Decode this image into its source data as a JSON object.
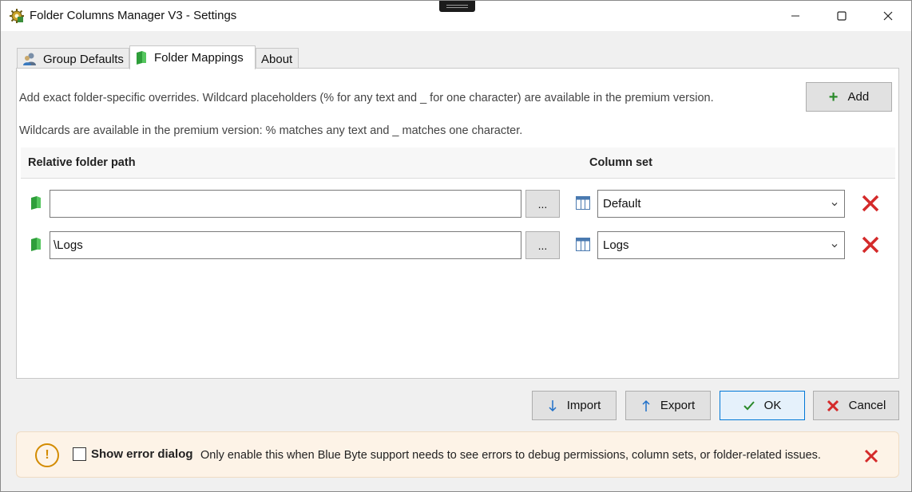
{
  "window": {
    "title": "Folder Columns Manager V3 - Settings"
  },
  "tabs": [
    {
      "label": "Group Defaults",
      "icon": "user-group-icon",
      "active": false
    },
    {
      "label": "Folder Mappings",
      "icon": "green-folder-icon",
      "active": true
    },
    {
      "label": "About",
      "icon": "",
      "active": false
    }
  ],
  "mappings": {
    "description_1": "Add exact folder-specific overrides. Wildcard placeholders (% for any text and _ for one character) are available in the premium version.",
    "description_2": "Wildcards are available in the premium version: % matches any text and _ matches one character.",
    "add_label": "Add",
    "columns": {
      "path": "Relative folder path",
      "column_set": "Column set"
    },
    "browse_label": "...",
    "rows": [
      {
        "path": "",
        "column_set": "Default"
      },
      {
        "path": "\\Logs",
        "column_set": "Logs"
      }
    ]
  },
  "buttons": {
    "import": "Import",
    "export": "Export",
    "ok": "OK",
    "cancel": "Cancel"
  },
  "infobar": {
    "checkbox_label": "Show error dialog",
    "checked": false,
    "message": "Only enable this when Blue Byte support needs to see errors to debug permissions, column sets, or folder-related issues."
  },
  "colors": {
    "accent": "#0078d7",
    "delete_red": "#d42a2a",
    "add_green": "#2a8a2a",
    "warning_orange": "#d38b00",
    "infobar_bg": "#fdf3e7"
  }
}
